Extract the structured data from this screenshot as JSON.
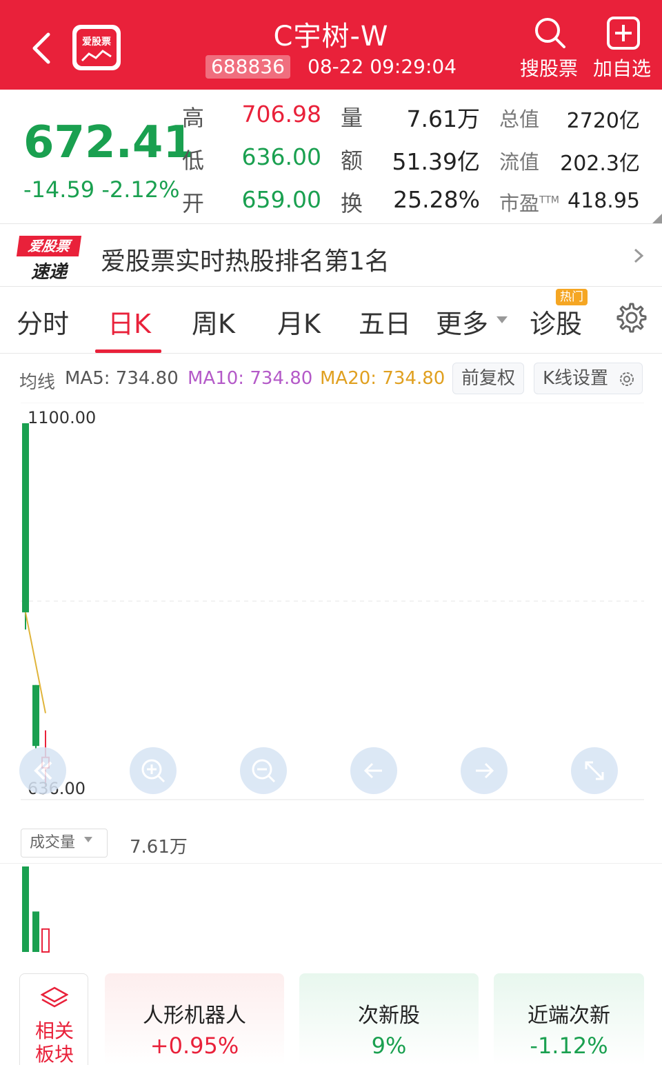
{
  "header": {
    "logo_text": "爱股票",
    "title": "C宇树-W",
    "code": "688836",
    "datetime": "08-22 09:29:04",
    "search_label": "搜股票",
    "add_label": "加自选"
  },
  "quote": {
    "price": "672.41",
    "change": "-14.59 -2.12%",
    "stats": {
      "high_label": "高",
      "high": "706.98",
      "low_label": "低",
      "low": "636.00",
      "open_label": "开",
      "open": "659.00",
      "vol_label": "量",
      "vol": "7.61万",
      "amt_label": "额",
      "amt": "51.39亿",
      "turn_label": "换",
      "turn": "25.28%",
      "mcap_label": "总值",
      "mcap": "2720亿",
      "float_label": "流值",
      "float": "202.3亿",
      "pe_label": "市盈",
      "pe_sup": "TTM",
      "pe": "418.95"
    }
  },
  "banner": {
    "logo_top": "爱股票",
    "logo_bottom": "速递",
    "text": "爱股票实时热股排名第1名"
  },
  "tabs": {
    "items": [
      "分时",
      "日K",
      "周K",
      "月K",
      "五日",
      "更多",
      "诊股"
    ],
    "active": "日K",
    "hot_badge": "热门"
  },
  "ma": {
    "label": "均线",
    "ma5": "MA5: 734.80",
    "ma10": "MA10: 734.80",
    "ma20": "MA20: 734.80",
    "btn_adjust": "前复权",
    "btn_settings": "K线设置"
  },
  "chart_data": {
    "type": "candlestick",
    "y_top_label": "1100.00",
    "y_bottom_label": "636.00",
    "ylim": [
      636.0,
      1100.0
    ],
    "candles": [
      {
        "open": 1100.0,
        "close": 858.0,
        "high": 1100.0,
        "low": 836.0,
        "direction": "down"
      },
      {
        "open": 765.0,
        "close": 687.0,
        "high": 765.0,
        "low": 684.0,
        "direction": "down"
      },
      {
        "open": 659.0,
        "close": 672.41,
        "high": 706.98,
        "low": 636.0,
        "direction": "up"
      }
    ],
    "ma_line": [
      858.0,
      729.0
    ],
    "volume": [
      11.2,
      5.3,
      3.0
    ],
    "colors": {
      "up": "#e9213a",
      "down": "#1aa050",
      "ma": "#e0b43a"
    }
  },
  "volume": {
    "select_label": "成交量",
    "value": "7.61万"
  },
  "sectors": {
    "left_label_1": "相关",
    "left_label_2": "板块",
    "items": [
      {
        "name": "人形机器人",
        "change": "+0.95%",
        "color": "#e9213a",
        "bg": "#fdeeee"
      },
      {
        "name": "次新股",
        "change": "9%",
        "color": "#1aa050",
        "bg": "#e8f7ee"
      },
      {
        "name": "近端次新",
        "change": "-1.12%",
        "color": "#1aa050",
        "bg": "#e8f7ee"
      }
    ]
  }
}
